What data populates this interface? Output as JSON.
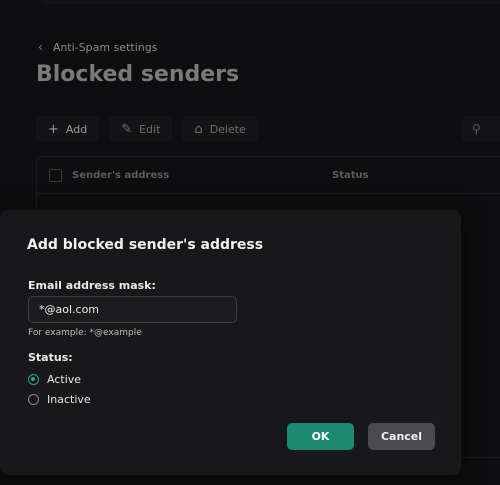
{
  "background": {
    "back_link": "Anti-Spam settings",
    "page_title": "Blocked senders",
    "toolbar": {
      "add_label": "Add",
      "edit_label": "Edit",
      "delete_label": "Delete"
    },
    "table": {
      "columns": [
        "Sender's address",
        "Status"
      ]
    }
  },
  "dialog": {
    "title": "Add blocked sender's address",
    "mask_label": "Email address mask:",
    "mask_value": "*@aol.com",
    "hint": "For example: *@example",
    "status_label": "Status:",
    "status_options": [
      {
        "label": "Active",
        "selected": true
      },
      {
        "label": "Inactive",
        "selected": false
      }
    ],
    "ok_label": "OK",
    "cancel_label": "Cancel"
  },
  "colors": {
    "accent": "#1b8a70",
    "radio_selected": "#23a88a",
    "secondary_button": "#4a4a50"
  }
}
